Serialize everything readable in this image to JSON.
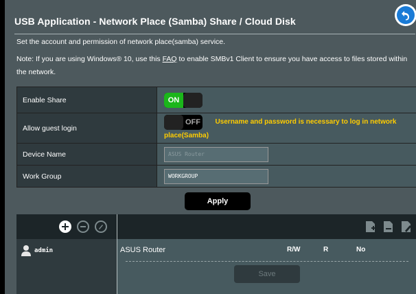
{
  "header": {
    "title": "USB Application - Network Place (Samba) Share / Cloud Disk",
    "back_icon": "back-arrow-icon"
  },
  "description": "Set the account and permission of network place(samba) service.",
  "note": {
    "prefix": "Note: If you are using Windows® 10, use this ",
    "link": "FAQ",
    "suffix": " to enable SMBv1 Client to ensure you have access to files stored within the network."
  },
  "form": {
    "enable_share": {
      "label": "Enable Share",
      "state": "ON"
    },
    "guest_login": {
      "label": "Allow guest login",
      "state": "OFF",
      "hint": "Username and password is necessary to log in network place(Samba)"
    },
    "device_name": {
      "label": "Device Name",
      "value": "ASUS Router"
    },
    "work_group": {
      "label": "Work Group",
      "value": "WORKGROUP"
    }
  },
  "apply_label": "Apply",
  "share": {
    "user": "admin",
    "folder": "ASUS Router",
    "perm_rw": "R/W",
    "perm_r": "R",
    "perm_no": "No",
    "save_label": "Save"
  },
  "colors": {
    "background": "#4d595d",
    "accent_on": "#1bb61b",
    "hint": "#ffcc00",
    "back_button": "#1a7bd6"
  }
}
